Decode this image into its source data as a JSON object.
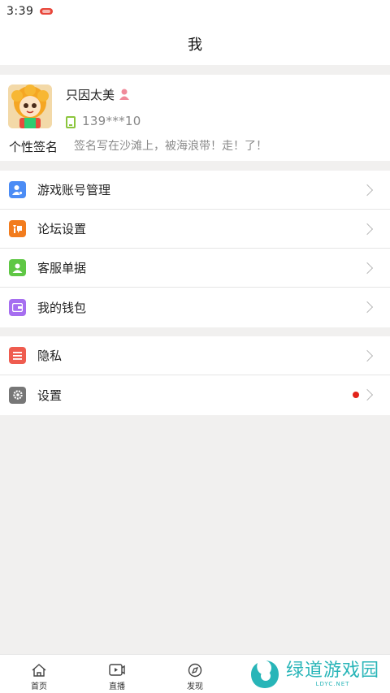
{
  "status_bar": {
    "time": "3:39"
  },
  "nav": {
    "title": "我"
  },
  "profile": {
    "username": "只因太美",
    "phone": "139***10",
    "signature_label": "个性签名",
    "signature_text": "签名写在沙滩上，被海浪带！走！了！"
  },
  "menu_group_1": [
    {
      "label": "游戏账号管理",
      "icon": "user-account-icon",
      "color": "#4b8cf5"
    },
    {
      "label": "论坛设置",
      "icon": "forum-icon",
      "color": "#f27c1e"
    },
    {
      "label": "客服单据",
      "icon": "customer-service-icon",
      "color": "#5fc745"
    },
    {
      "label": "我的钱包",
      "icon": "wallet-icon",
      "color": "#a66ef0"
    }
  ],
  "menu_group_2": [
    {
      "label": "隐私",
      "icon": "privacy-icon",
      "color": "#ef5c4f"
    },
    {
      "label": "设置",
      "icon": "settings-gear-icon",
      "color": "#777777",
      "has_notification_dot": true
    }
  ],
  "tabbar": [
    {
      "label": "首页",
      "icon": "home-icon"
    },
    {
      "label": "直播",
      "icon": "live-video-icon"
    },
    {
      "label": "发现",
      "icon": "discover-icon"
    }
  ],
  "watermark": {
    "cn": "绿道游戏园",
    "en": "LDYC.NET"
  },
  "colors": {
    "accent_red": "#e2231a",
    "phone_green": "#8cc63e",
    "watermark_teal": "#28b5b8"
  }
}
